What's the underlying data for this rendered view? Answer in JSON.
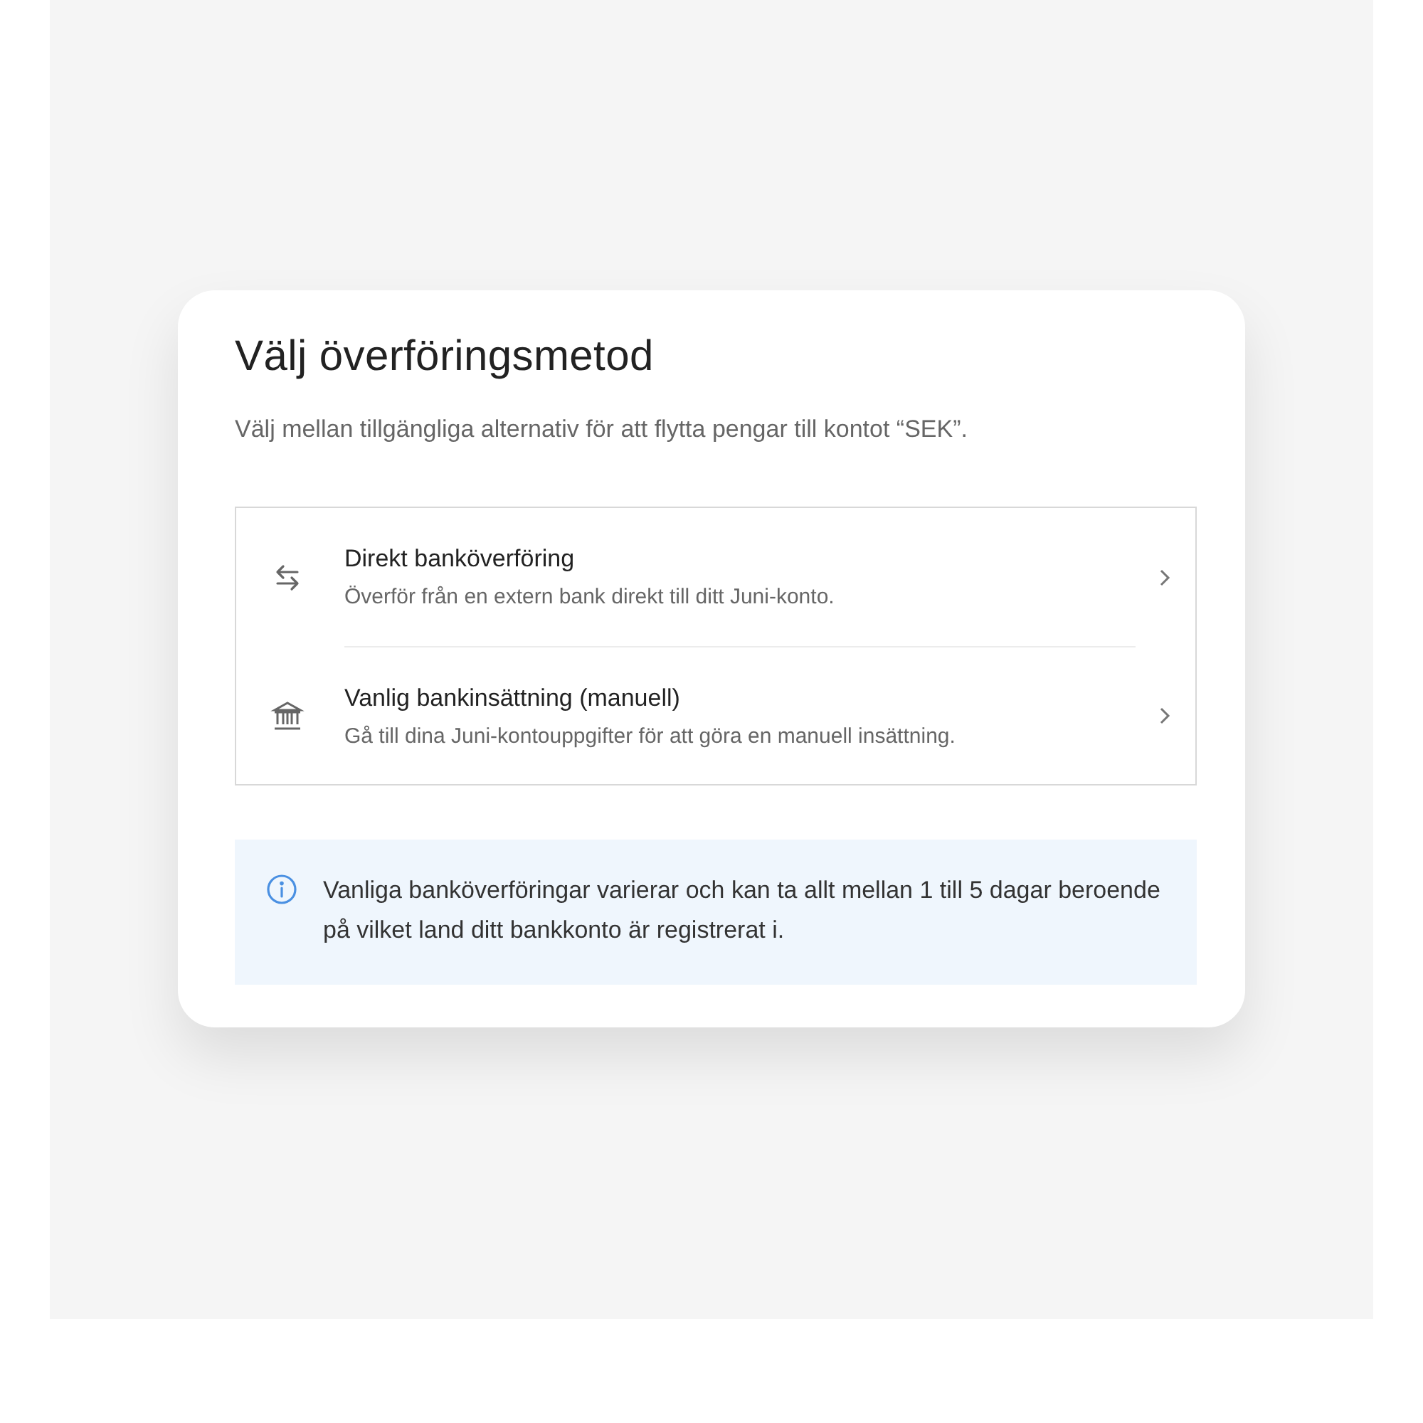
{
  "dialog": {
    "title": "Välj överföringsmetod",
    "subtitle": "Välj mellan tillgängliga alternativ för att flytta pengar till kontot “SEK”.",
    "options": [
      {
        "kind": "transfer",
        "title": "Direkt banköverföring",
        "description": "Överför från en extern bank direkt till ditt Juni-konto."
      },
      {
        "kind": "bank",
        "title": "Vanlig bankinsättning (manuell)",
        "description": "Gå till dina Juni-kontouppgifter för att göra en manuell insättning."
      }
    ],
    "notice": {
      "text": "Vanliga banköverföringar varierar och kan ta allt mellan 1 till 5 dagar beroende på vilket land ditt bankkonto är registrerat i."
    }
  }
}
